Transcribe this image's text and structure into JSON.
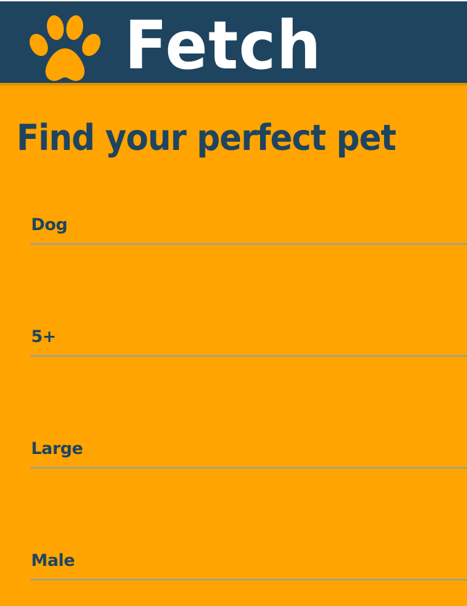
{
  "header": {
    "brand_title": "Fetch",
    "background_color": "#1e4460",
    "logo_icon": "paw-icon"
  },
  "main": {
    "title": "Find your perfect pet",
    "filters": [
      {
        "name": "pet-type-select",
        "value": "Dog"
      },
      {
        "name": "age-select",
        "value": "5+"
      },
      {
        "name": "size-select",
        "value": "Large"
      },
      {
        "name": "gender-select",
        "value": "Male"
      }
    ]
  },
  "colors": {
    "accent": "#ffa400",
    "brand": "#1e4460",
    "divider": "#8fa0a9",
    "header_text": "#ffffff"
  }
}
